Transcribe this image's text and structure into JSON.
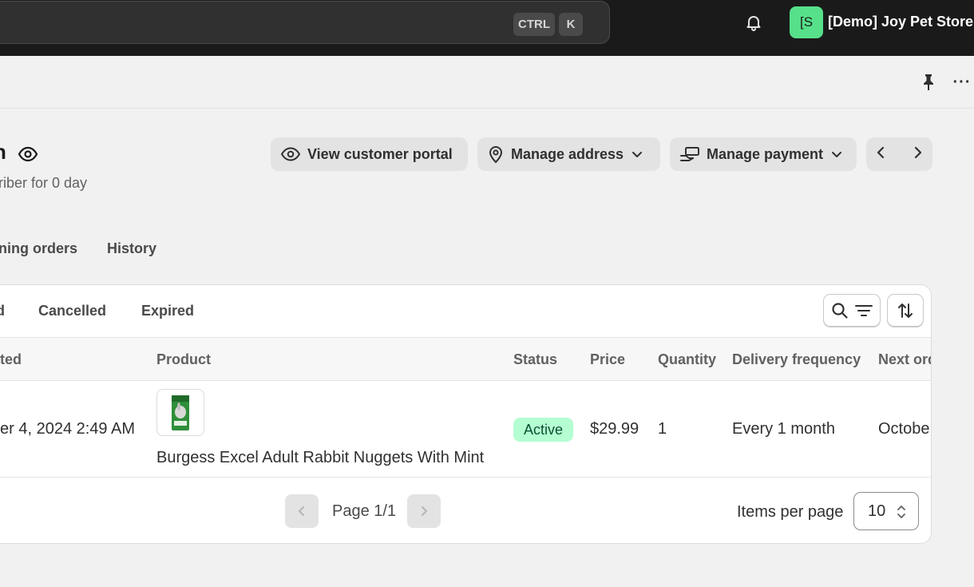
{
  "topbar": {
    "search": {
      "kbd_ctrl": "CTRL",
      "kbd_k": "K"
    },
    "store": {
      "avatar": "[S",
      "name": "[Demo] Joy Pet Store"
    },
    "icons": {
      "bell": "bell-icon"
    }
  },
  "subbar": {
    "icons": {
      "pin": "pin-icon",
      "more": "more-icon"
    },
    "more_label": "···"
  },
  "header": {
    "title": "n",
    "subscriber_text": "riber for 0 day",
    "buttons": {
      "portal": "View customer portal",
      "address": "Manage address",
      "payment": "Manage payment"
    }
  },
  "tabs": {
    "upcoming": "ning orders",
    "history": "History"
  },
  "filters": {
    "partial": "d",
    "cancelled": "Cancelled",
    "expired": "Expired"
  },
  "table": {
    "headers": {
      "created": "ted",
      "product": "Product",
      "status": "Status",
      "price": "Price",
      "quantity": "Quantity",
      "frequency": "Delivery frequency",
      "next_order": "Next ord"
    },
    "rows": [
      {
        "created": "er 4, 2024 2:49 AM",
        "product": "Burgess Excel Adult Rabbit Nuggets With Mint",
        "status": "Active",
        "price": "$29.99",
        "quantity": "1",
        "frequency": "Every 1 month",
        "next_order": "Octobe"
      }
    ]
  },
  "pagination": {
    "page_text": "Page 1/1",
    "items_label": "Items per page",
    "items_value": "10"
  },
  "colors": {
    "topbar": "#1a1a1a",
    "avatar": "#56e08a",
    "badge_bg": "#b4fed2",
    "badge_text": "#0c5132"
  }
}
